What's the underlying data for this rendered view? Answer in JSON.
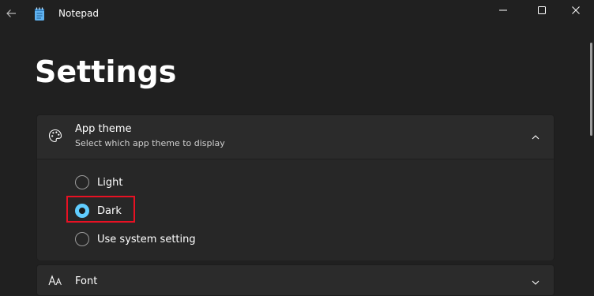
{
  "window": {
    "title": "Notepad"
  },
  "page": {
    "title": "Settings"
  },
  "app_theme": {
    "title": "App theme",
    "description": "Select which app theme to display",
    "options": [
      {
        "label": "Light",
        "selected": false
      },
      {
        "label": "Dark",
        "selected": true
      },
      {
        "label": "Use system setting",
        "selected": false
      }
    ]
  },
  "font": {
    "title": "Font"
  },
  "colors": {
    "accent": "#60cdff",
    "highlight": "#e81123",
    "background": "#202020",
    "card": "#2b2b2b"
  },
  "icons": {
    "back": "back-arrow-icon",
    "app": "notepad-icon",
    "palette": "palette-icon",
    "font": "font-icon",
    "chevron_up": "chevron-up-icon",
    "chevron_down": "chevron-down-icon"
  }
}
